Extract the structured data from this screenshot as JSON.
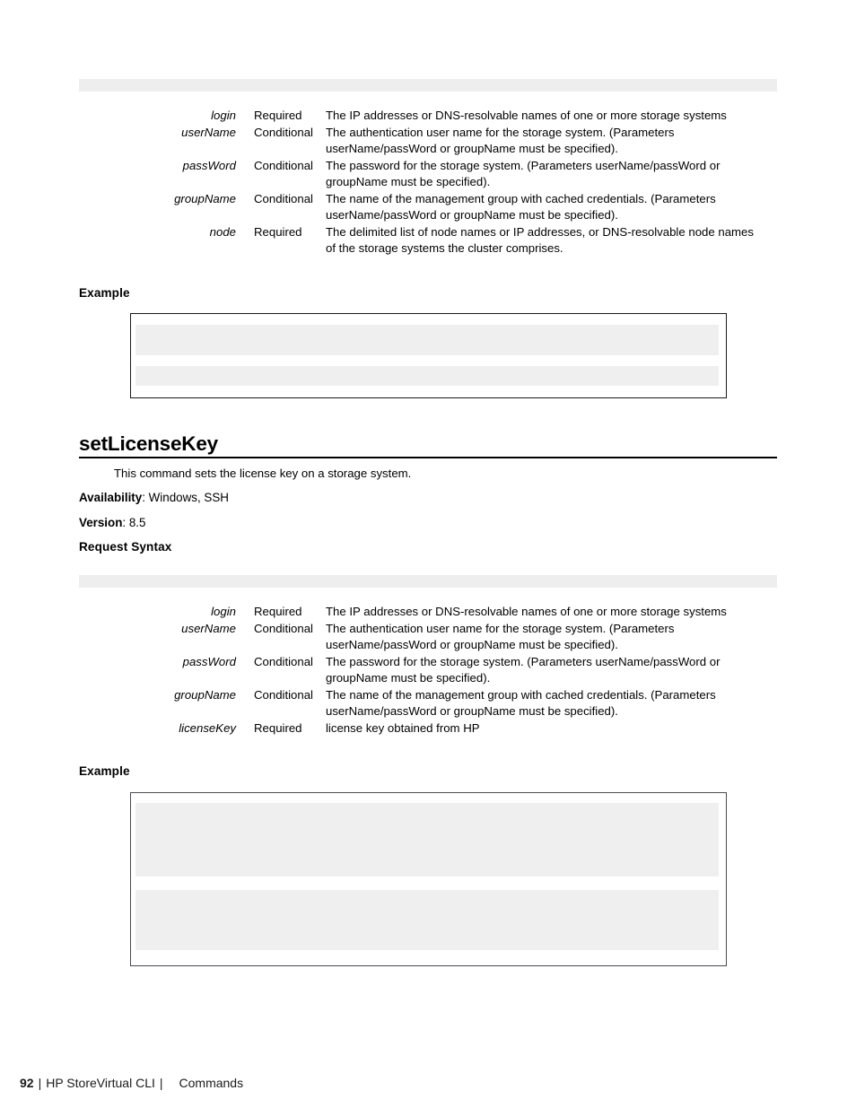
{
  "page": {
    "number": "92",
    "product": "HP StoreVirtual CLI",
    "section": "Commands",
    "separator": "|"
  },
  "colors": {
    "syntax_bar": "#eeeeee",
    "code_bar": "#efefef",
    "box_border_top": "#1a1a1a",
    "box_border_bottom": "#4a4a50",
    "rule": "#000000",
    "text": "#000000"
  },
  "sections": [
    {
      "id": "previous-command-tail",
      "syntax_bar": {
        "visible": true,
        "label": ""
      },
      "parameters": [
        {
          "name": "login",
          "requirement": "Required",
          "description": "The IP addresses or DNS-resolvable names of one or more storage systems"
        },
        {
          "name": "userName",
          "requirement": "Conditional",
          "description": "The authentication user name for the storage system. (Parameters userName/passWord or groupName must be specified)."
        },
        {
          "name": "passWord",
          "requirement": "Conditional",
          "description": "The password for the storage system. (Parameters userName/passWord or groupName must be specified)."
        },
        {
          "name": "groupName",
          "requirement": "Conditional",
          "description": "The name of the management group with cached credentials. (Parameters userName/passWord or groupName must be specified)."
        },
        {
          "name": "node",
          "requirement": "Required",
          "description": "The delimited list of node names or IP addresses, or DNS-resolvable node names of the storage systems the cluster comprises."
        }
      ],
      "example_label": "Example",
      "example_box": {
        "code_bars": 2
      }
    },
    {
      "id": "setLicenseKey",
      "title": "setLicenseKey",
      "description": "This command sets the license key on a storage system.",
      "availability_label": "Availability",
      "availability_value": ": Windows, SSH",
      "version_label": "Version",
      "version_value": ": 8.5",
      "request_syntax_label": "Request Syntax",
      "syntax_bar": {
        "visible": true,
        "label": ""
      },
      "parameters": [
        {
          "name": "login",
          "requirement": "Required",
          "description": "The IP addresses or DNS-resolvable names of one or more storage systems"
        },
        {
          "name": "userName",
          "requirement": "Conditional",
          "description": "The authentication user name for the storage system. (Parameters userName/passWord or groupName must be specified)."
        },
        {
          "name": "passWord",
          "requirement": "Conditional",
          "description": "The password for the storage system. (Parameters userName/passWord or groupName must be specified)."
        },
        {
          "name": "groupName",
          "requirement": "Conditional",
          "description": "The name of the management group with cached credentials. (Parameters userName/passWord or groupName must be specified)."
        },
        {
          "name": "licenseKey",
          "requirement": "Required",
          "description": "license key obtained from HP"
        }
      ],
      "example_label": "Example",
      "example_box": {
        "code_bars": 2
      }
    }
  ]
}
